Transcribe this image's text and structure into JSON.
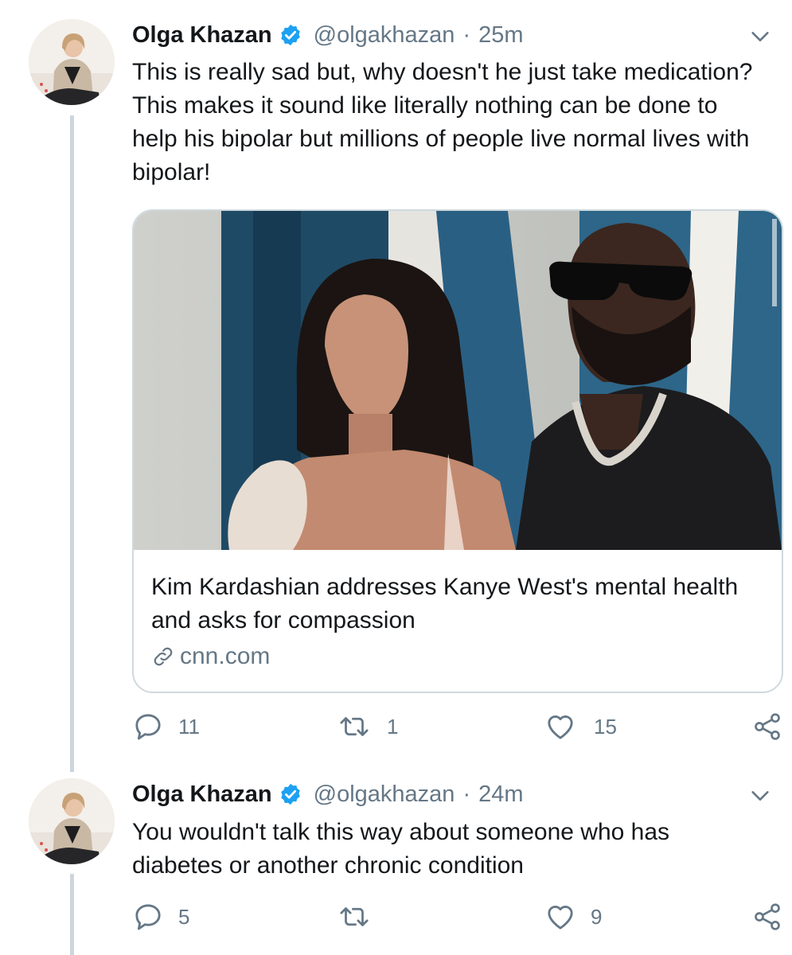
{
  "tweets": [
    {
      "author_name": "Olga Khazan",
      "handle": "@olgakhazan",
      "separator": "·",
      "time": "25m",
      "text": "This is really sad but, why doesn't he just take medication? This makes it sound like literally nothing can be done to help his bipolar but millions of people live normal lives with bipolar!",
      "card": {
        "title": "Kim Kardashian addresses Kanye West's mental health and asks for compassion",
        "domain": "cnn.com"
      },
      "replies": "11",
      "retweets": "1",
      "likes": "15"
    },
    {
      "author_name": "Olga Khazan",
      "handle": "@olgakhazan",
      "separator": "·",
      "time": "24m",
      "text": "You wouldn't talk this way about someone who has diabetes or another chronic condition",
      "replies": "5",
      "retweets": "",
      "likes": "9"
    }
  ],
  "icons": [
    "verified-badge-icon",
    "chevron-down-icon",
    "reply-icon",
    "retweet-icon",
    "like-icon",
    "share-icon",
    "link-icon"
  ],
  "colors": {
    "verified": "#1da1f2",
    "secondary_text": "#657786",
    "thread_line": "#cdd6dd",
    "card_border": "#cfd9de"
  }
}
